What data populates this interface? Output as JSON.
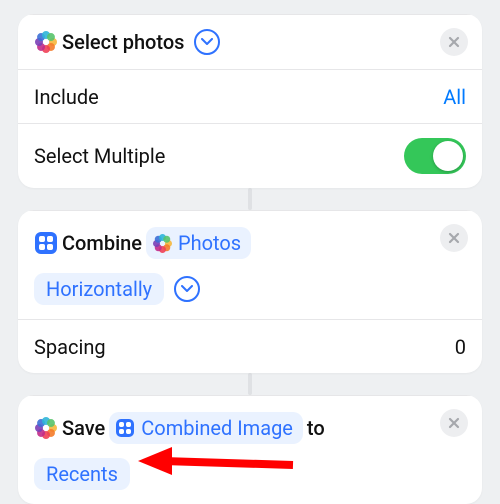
{
  "colors": {
    "link": "#007aff",
    "token": "#2f72ff",
    "toggleOn": "#34c759"
  },
  "card1": {
    "title": "Select photos",
    "includeLabel": "Include",
    "includeValue": "All",
    "multipleLabel": "Select Multiple",
    "multipleOn": true
  },
  "card2": {
    "verb": "Combine",
    "inputToken": "Photos",
    "modeToken": "Horizontally",
    "spacingLabel": "Spacing",
    "spacingValue": "0"
  },
  "card3": {
    "verb": "Save",
    "inputToken": "Combined Image",
    "joiner": "to",
    "albumToken": "Recents"
  }
}
